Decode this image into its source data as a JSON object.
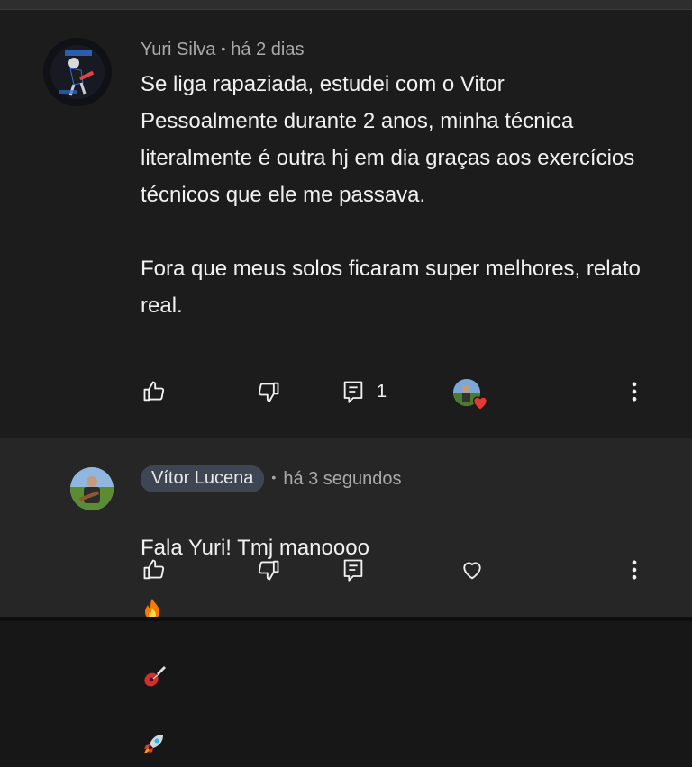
{
  "comment": {
    "author": "Yuri Silva",
    "time": "há 2 dias",
    "text": "Se liga rapaziada, estudei com o Vitor Pessoalmente durante 2 anos, minha técnica literalmente é outra hj em dia graças aos exercícios técnicos que ele me passava.\n\nFora que meus solos ficaram super melhores, relato real.",
    "reply_count": "1",
    "icons": {
      "like": "thumbs-up-icon",
      "dislike": "thumbs-down-icon",
      "reply": "reply-icon",
      "creator_heart": "creator-heart-icon",
      "more": "more-vertical-icon"
    }
  },
  "reply": {
    "author": "Vítor Lucena",
    "time": "há 3 segundos",
    "text": "Fala Yuri! Tmj manoooo",
    "emojis": [
      "fire",
      "guitar",
      "rocket"
    ],
    "icons": {
      "like": "thumbs-up-icon",
      "dislike": "thumbs-down-icon",
      "reply": "reply-icon",
      "heart": "heart-outline-icon",
      "more": "more-vertical-icon"
    }
  },
  "colors": {
    "background": "#171717",
    "comment_bg": "#1c1c1c",
    "reply_bg": "#262626",
    "author_chip": "#3e4654",
    "heart": "#e53935"
  }
}
